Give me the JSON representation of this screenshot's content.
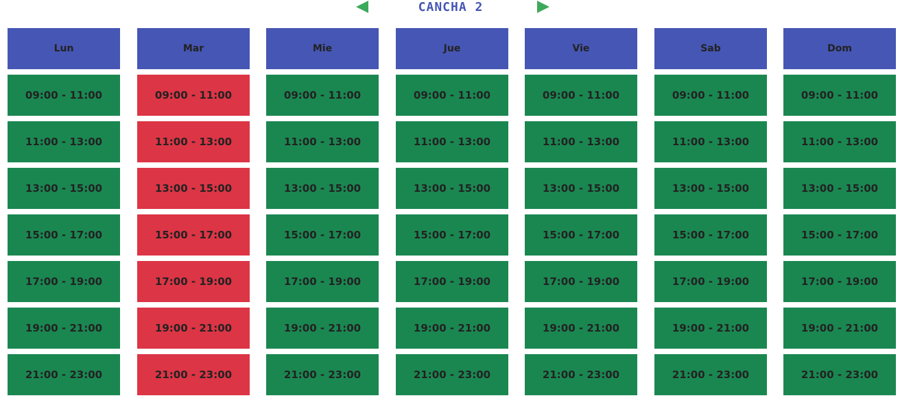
{
  "court": {
    "title": "CANCHA 2",
    "prev_icon": "triangle-left-icon",
    "next_icon": "triangle-right-icon",
    "title_color": "#4656b4",
    "arrow_color": "#3caa5a"
  },
  "colors": {
    "day_header": "#4656b4",
    "available": "#1a8751",
    "booked": "#dc3545"
  },
  "days": [
    {
      "label": "Lun",
      "slots": [
        {
          "time": "09:00 - 11:00",
          "status": "available"
        },
        {
          "time": "11:00 - 13:00",
          "status": "available"
        },
        {
          "time": "13:00 - 15:00",
          "status": "available"
        },
        {
          "time": "15:00 - 17:00",
          "status": "available"
        },
        {
          "time": "17:00 - 19:00",
          "status": "available"
        },
        {
          "time": "19:00 - 21:00",
          "status": "available"
        },
        {
          "time": "21:00 - 23:00",
          "status": "available"
        }
      ]
    },
    {
      "label": "Mar",
      "slots": [
        {
          "time": "09:00 - 11:00",
          "status": "booked"
        },
        {
          "time": "11:00 - 13:00",
          "status": "booked"
        },
        {
          "time": "13:00 - 15:00",
          "status": "booked"
        },
        {
          "time": "15:00 - 17:00",
          "status": "booked"
        },
        {
          "time": "17:00 - 19:00",
          "status": "booked"
        },
        {
          "time": "19:00 - 21:00",
          "status": "booked"
        },
        {
          "time": "21:00 - 23:00",
          "status": "booked"
        }
      ]
    },
    {
      "label": "Mie",
      "slots": [
        {
          "time": "09:00 - 11:00",
          "status": "available"
        },
        {
          "time": "11:00 - 13:00",
          "status": "available"
        },
        {
          "time": "13:00 - 15:00",
          "status": "available"
        },
        {
          "time": "15:00 - 17:00",
          "status": "available"
        },
        {
          "time": "17:00 - 19:00",
          "status": "available"
        },
        {
          "time": "19:00 - 21:00",
          "status": "available"
        },
        {
          "time": "21:00 - 23:00",
          "status": "available"
        }
      ]
    },
    {
      "label": "Jue",
      "slots": [
        {
          "time": "09:00 - 11:00",
          "status": "available"
        },
        {
          "time": "11:00 - 13:00",
          "status": "available"
        },
        {
          "time": "13:00 - 15:00",
          "status": "available"
        },
        {
          "time": "15:00 - 17:00",
          "status": "available"
        },
        {
          "time": "17:00 - 19:00",
          "status": "available"
        },
        {
          "time": "19:00 - 21:00",
          "status": "available"
        },
        {
          "time": "21:00 - 23:00",
          "status": "available"
        }
      ]
    },
    {
      "label": "Vie",
      "slots": [
        {
          "time": "09:00 - 11:00",
          "status": "available"
        },
        {
          "time": "11:00 - 13:00",
          "status": "available"
        },
        {
          "time": "13:00 - 15:00",
          "status": "available"
        },
        {
          "time": "15:00 - 17:00",
          "status": "available"
        },
        {
          "time": "17:00 - 19:00",
          "status": "available"
        },
        {
          "time": "19:00 - 21:00",
          "status": "available"
        },
        {
          "time": "21:00 - 23:00",
          "status": "available"
        }
      ]
    },
    {
      "label": "Sab",
      "slots": [
        {
          "time": "09:00 - 11:00",
          "status": "available"
        },
        {
          "time": "11:00 - 13:00",
          "status": "available"
        },
        {
          "time": "13:00 - 15:00",
          "status": "available"
        },
        {
          "time": "15:00 - 17:00",
          "status": "available"
        },
        {
          "time": "17:00 - 19:00",
          "status": "available"
        },
        {
          "time": "19:00 - 21:00",
          "status": "available"
        },
        {
          "time": "21:00 - 23:00",
          "status": "available"
        }
      ]
    },
    {
      "label": "Dom",
      "slots": [
        {
          "time": "09:00 - 11:00",
          "status": "available"
        },
        {
          "time": "11:00 - 13:00",
          "status": "available"
        },
        {
          "time": "13:00 - 15:00",
          "status": "available"
        },
        {
          "time": "15:00 - 17:00",
          "status": "available"
        },
        {
          "time": "17:00 - 19:00",
          "status": "available"
        },
        {
          "time": "19:00 - 21:00",
          "status": "available"
        },
        {
          "time": "21:00 - 23:00",
          "status": "available"
        }
      ]
    }
  ]
}
